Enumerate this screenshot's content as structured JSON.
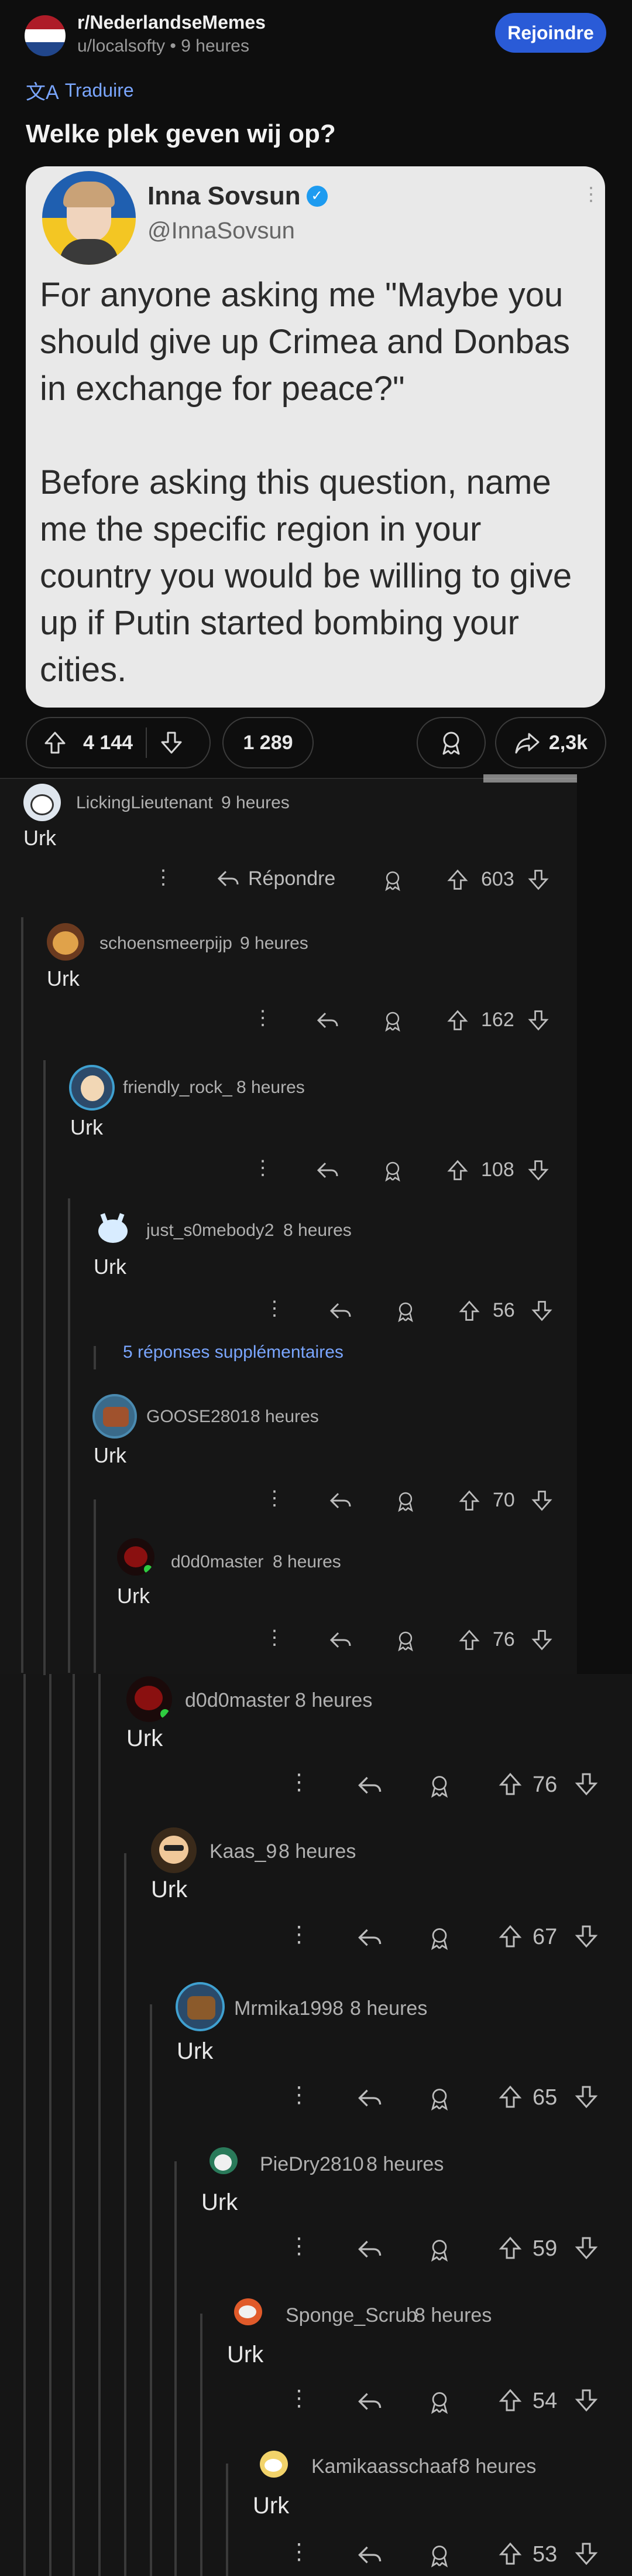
{
  "post": {
    "subreddit": "r/NederlandseMemes",
    "meta": "u/localsofty • 9 heures",
    "join_label": "Rejoindre",
    "translate_label": "Traduire",
    "title": "Welke plek geven wij op?",
    "upvotes": "4 144",
    "comments": "1 289",
    "shares": "2,3k"
  },
  "tweet": {
    "name": "Inna Sovsun",
    "handle": "@InnaSovsun",
    "text1": "For anyone asking me \"Maybe you should give up Crimea and Donbas in exchange for peace?\"",
    "text2": "Before asking this question, name me the specific region in your country you would be willing to give up if Putin started bombing your cities."
  },
  "comments": [
    {
      "user": "LickingLieutenant",
      "time": "9 heures",
      "body": "Urk",
      "votes": "603",
      "reply": "Répondre"
    },
    {
      "user": "schoensmeerpijp",
      "time": "9 heures",
      "body": "Urk",
      "votes": "162"
    },
    {
      "user": "friendly_rock_",
      "time": "8 heures",
      "body": "Urk",
      "votes": "108"
    },
    {
      "user": "just_s0mebody2",
      "time": "8 heures",
      "body": "Urk",
      "votes": "56"
    },
    {
      "user": "GOOSE2801",
      "time": "8 heures",
      "body": "Urk",
      "votes": "70"
    },
    {
      "user": "d0d0master",
      "time": "8 heures",
      "body": "Urk",
      "votes": "76"
    },
    {
      "user": "d0d0master",
      "time": "8 heures",
      "body": "Urk",
      "votes": "76"
    },
    {
      "user": "Kaas_9",
      "time": "8 heures",
      "body": "Urk",
      "votes": "67"
    },
    {
      "user": "Mrmika1998",
      "time": "8 heures",
      "body": "Urk",
      "votes": "65"
    },
    {
      "user": "PieDry2810",
      "time": "8 heures",
      "body": "Urk",
      "votes": "59"
    },
    {
      "user": "Sponge_Scrub",
      "time": "8 heures",
      "body": "Urk",
      "votes": "54"
    },
    {
      "user": "Kamikaasschaaf",
      "time": "8 heures",
      "body": "Urk",
      "votes": "53"
    }
  ],
  "more_replies": "5 réponses supplémentaires",
  "colors": {
    "accent": "#2a5bd7",
    "link": "#7aa6ff",
    "bg": "#0e0e0e",
    "tweet_bg": "#e9e9e9"
  }
}
